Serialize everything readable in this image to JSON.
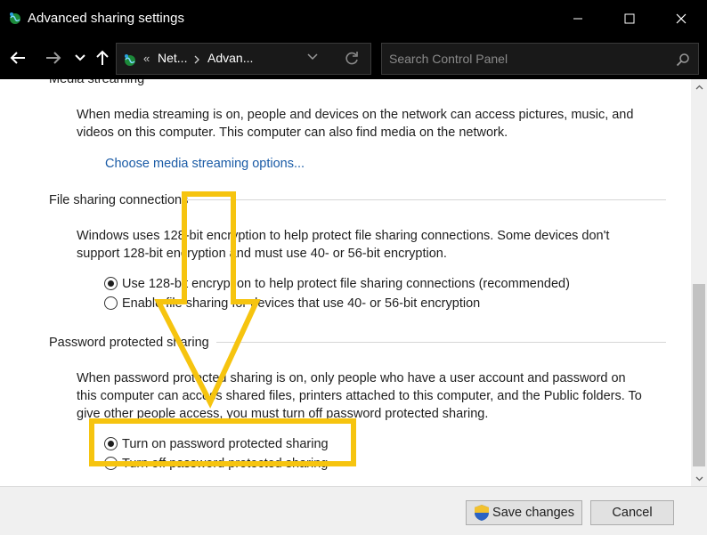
{
  "window": {
    "title": "Advanced sharing settings"
  },
  "nav": {
    "breadcrumb_sep": "«",
    "crumbs": [
      "Net...",
      "Advan..."
    ],
    "search_placeholder": "Search Control Panel"
  },
  "sections": {
    "media": {
      "title": "Media streaming",
      "desc_line1": "When media streaming is on, people and devices on the network can access pictures, music, and",
      "desc_line2": "videos on this computer. This computer can also find media on the network.",
      "link": "Choose media streaming options..."
    },
    "file_sharing": {
      "title": "File sharing connections",
      "desc_line1": "Windows uses 128-bit encryption to help protect file sharing connections. Some devices don't",
      "desc_line2": "support 128-bit encryption and must use 40- or 56-bit encryption.",
      "options": [
        {
          "label": "Use 128-bit encryption to help protect file sharing connections (recommended)",
          "selected": true
        },
        {
          "label": "Enable file sharing for devices that use 40- or 56-bit encryption",
          "selected": false
        }
      ]
    },
    "password": {
      "title": "Password protected sharing",
      "desc_line1": "When password protected sharing is on, only people who have a user account and password on",
      "desc_line2": "this computer can access shared files, printers attached to this computer, and the Public folders. To",
      "desc_line3": "give other people access, you must turn off password protected sharing.",
      "options": [
        {
          "label": "Turn on password protected sharing",
          "selected": true
        },
        {
          "label": "Turn off password protected sharing",
          "selected": false
        }
      ]
    }
  },
  "footer": {
    "save_label": "Save changes",
    "cancel_label": "Cancel"
  },
  "colors": {
    "annotation": "#f6c40f",
    "link": "#1a5ba6"
  },
  "icons": {
    "app": "network-globe-icon",
    "save": "uac-shield-icon",
    "search": "search-icon",
    "refresh": "refresh-icon"
  }
}
